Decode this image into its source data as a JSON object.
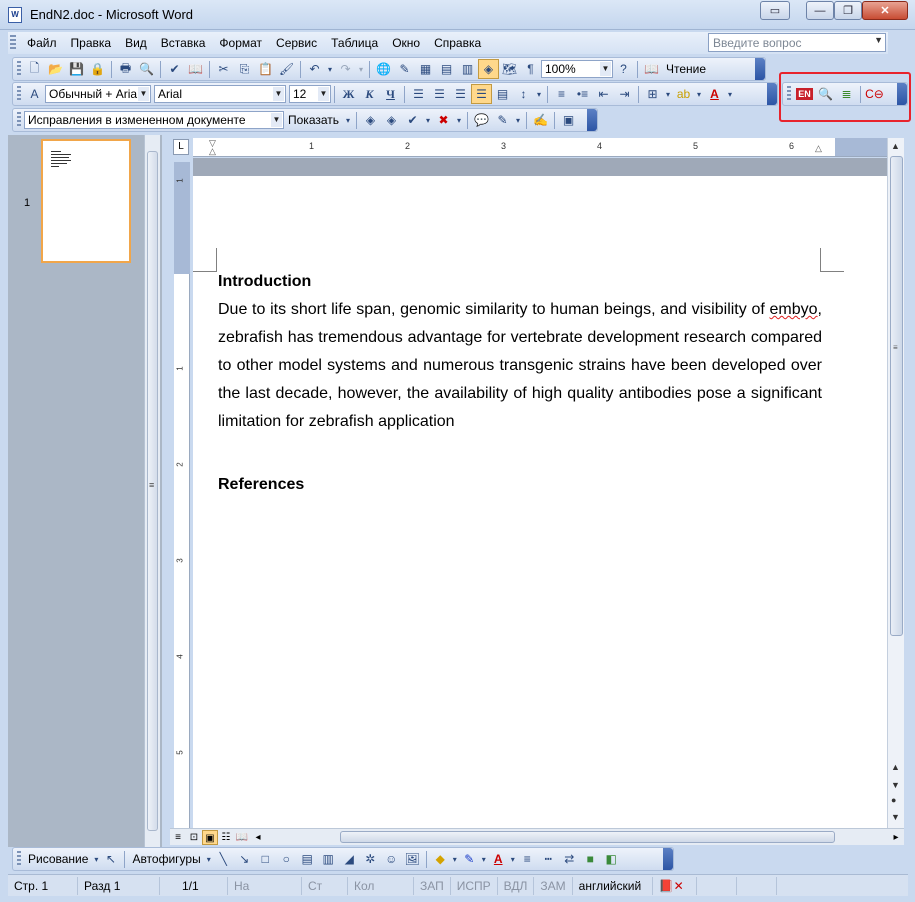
{
  "window": {
    "title": "EndN2.doc - Microsoft Word",
    "doc_icon_text": "W"
  },
  "menu": {
    "items": [
      "Файл",
      "Правка",
      "Вид",
      "Вставка",
      "Формат",
      "Сервис",
      "Таблица",
      "Окно",
      "Справка"
    ],
    "ask_placeholder": "Введите вопрос"
  },
  "standard_toolbar": {
    "zoom": "100%",
    "reading_label": "Чтение"
  },
  "format_toolbar": {
    "style": "Обычный + Aria",
    "font": "Arial",
    "size": "12"
  },
  "review_toolbar": {
    "display_mode": "Исправления в измененном документе",
    "show_label": "Показать"
  },
  "endnote_toolbar": {
    "en_label": "EN"
  },
  "thumbnails": {
    "page_number": "1"
  },
  "ruler": {
    "h_numbers": [
      "1",
      "2",
      "3",
      "4",
      "5",
      "6"
    ],
    "v_numbers": [
      "1",
      "1",
      "2",
      "3",
      "4",
      "5"
    ]
  },
  "document": {
    "heading1": "Introduction",
    "para_before": "Due to its short life span, genomic similarity to human beings, and visibility of ",
    "misspelled": "embyo",
    "para_after": ", zebrafish has tremendous advantage for vertebrate development research compared to other model systems and numerous transgenic strains have been developed over the last decade, however, the availability of high quality antibodies pose a significant limitation for zebrafish application",
    "heading2": "References"
  },
  "drawing_toolbar": {
    "draw_label": "Рисование",
    "autoshapes_label": "Автофигуры"
  },
  "status": {
    "page": "Стр.  1",
    "section": "Разд  1",
    "pages": "1/1",
    "at": "На",
    "line": "Ст",
    "col": "Кол",
    "rec": "ЗАП",
    "trk": "ИСПР",
    "ext": "ВДЛ",
    "ovr": "ЗАМ",
    "language": "английский"
  }
}
